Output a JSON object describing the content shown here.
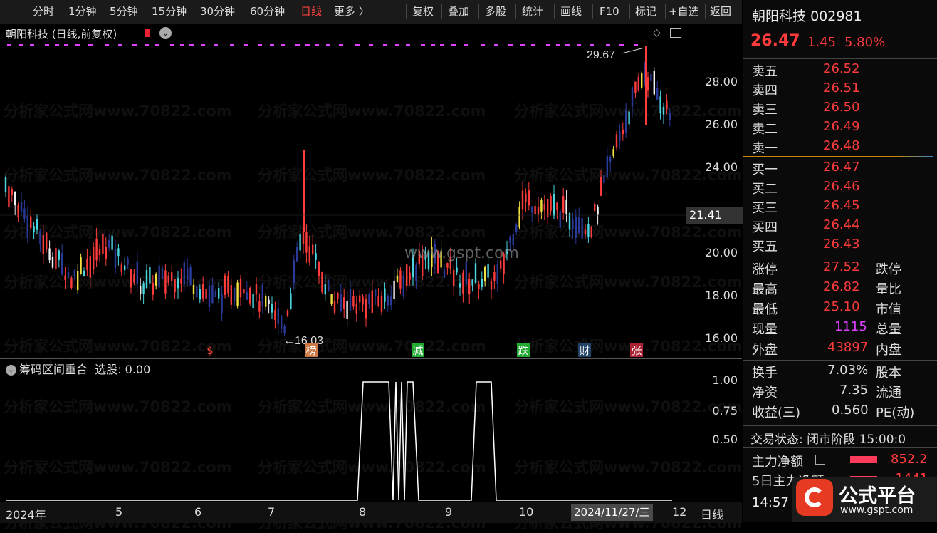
{
  "toolbar": {
    "period_tabs": [
      "分时",
      "1分钟",
      "5分钟",
      "15分钟",
      "30分钟",
      "60分钟",
      "日线",
      "更多 〉"
    ],
    "active_tab": "日线",
    "actions": [
      "复权",
      "叠加",
      "多股",
      "统计",
      "画线",
      "F10",
      "标记",
      "+自选",
      "返回"
    ]
  },
  "chart": {
    "title": "朝阳科技 (日线,前复权)",
    "price_ticks": [
      "28.00",
      "26.00",
      "24.00",
      "20.00",
      "18.00",
      "16.00"
    ],
    "current_price_label": "21.41",
    "high_annotation": "29.67",
    "low_annotation": "16.03",
    "event_markers": [
      "$",
      "榜",
      "减",
      "跌",
      "财",
      "张"
    ],
    "watermark": "分析家公式网www.70822.com",
    "site_watermark": "www.gspt.com"
  },
  "indicator": {
    "title": "筹码区间重合",
    "select_label": "选股: 0.00",
    "ticks": [
      "1.00",
      "0.75",
      "0.50"
    ]
  },
  "date_axis": {
    "labels": [
      "2024年",
      "5",
      "6",
      "7",
      "8",
      "9",
      "10",
      "12"
    ],
    "cursor_date": "2024/11/27/三",
    "period": "日线"
  },
  "quote": {
    "name": "朝阳科技",
    "code": "002981",
    "price": "26.47",
    "change": "1.45",
    "change_pct": "5.80%",
    "asks": [
      {
        "label": "卖五",
        "price": "26.52"
      },
      {
        "label": "卖四",
        "price": "26.51"
      },
      {
        "label": "卖三",
        "price": "26.50"
      },
      {
        "label": "卖二",
        "price": "26.49"
      },
      {
        "label": "卖一",
        "price": "26.48"
      }
    ],
    "bids": [
      {
        "label": "买一",
        "price": "26.47"
      },
      {
        "label": "买二",
        "price": "26.46"
      },
      {
        "label": "买三",
        "price": "26.45"
      },
      {
        "label": "买四",
        "price": "26.44"
      },
      {
        "label": "买五",
        "price": "26.43"
      }
    ],
    "stats": [
      {
        "label": "涨停",
        "value": "27.52",
        "label2": "跌停"
      },
      {
        "label": "最高",
        "value": "26.82",
        "label2": "量比"
      },
      {
        "label": "最低",
        "value": "25.10",
        "label2": "市值"
      },
      {
        "label": "现量",
        "value": "1115",
        "label2": "总量"
      },
      {
        "label": "外盘",
        "value": "43897",
        "label2": "内盘"
      }
    ],
    "stats2": [
      {
        "label": "换手",
        "value": "7.03%",
        "label2": "股本"
      },
      {
        "label": "净资",
        "value": "7.35",
        "label2": "流通"
      },
      {
        "label": "收益(三)",
        "value": "0.560",
        "label2": "PE(动)"
      }
    ],
    "trade_status": "交易状态: 闭市阶段 15:00:0",
    "main_flow_label": "主力净额",
    "main_flow_value": "852.2",
    "five_day_label": "5日主力净额",
    "five_day_value": "-1441",
    "time": "14:57"
  },
  "brand": {
    "name": "公式平台",
    "url": "www.gspt.com"
  },
  "colors": {
    "up": "#ff3b3b",
    "down_cyan": "#4ad6e0",
    "down_blue": "#2a3a9a",
    "yellow": "#f0e040",
    "magenta": "#e040ff",
    "ind_line": "#ffffff"
  }
}
